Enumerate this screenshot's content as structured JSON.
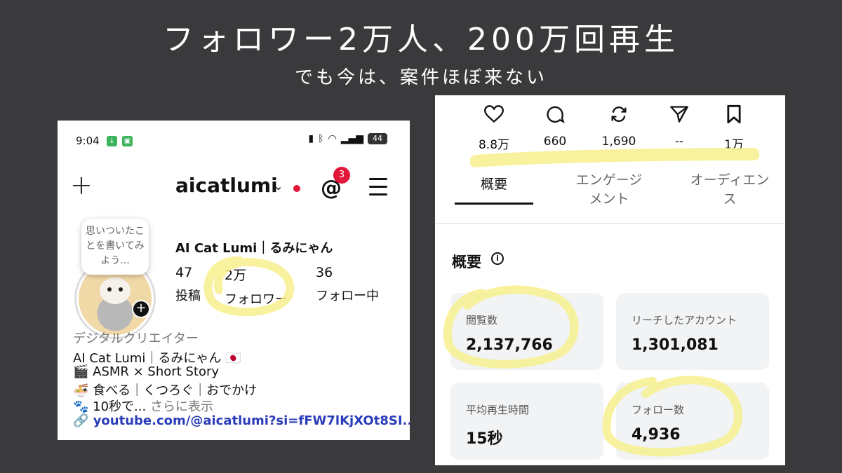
{
  "headline": "フォロワー2万人、200万回再生",
  "subheadline": "でも今は、案件ほぼ来ない",
  "profile_screen": {
    "status_bar": {
      "time": "9:04",
      "battery": "44"
    },
    "top_bar": {
      "username": "aicatlumi",
      "threads_badge": "3"
    },
    "note_bubble": "思いついたことを書いてみよう...",
    "display_name": "AI Cat Lumi｜るみにゃん",
    "stats": [
      {
        "value": "47",
        "label": "投稿"
      },
      {
        "value": "2万",
        "label": "フォロワー"
      },
      {
        "value": "36",
        "label": "フォロー中"
      }
    ],
    "category": "デジタルクリエイター",
    "bio_lines": [
      "AI Cat Lumi｜るみにゃん 🇯🇵",
      "🎬 ASMR × Short Story",
      "🍜 食べる｜くつろぐ｜おでかけ"
    ],
    "bio_last_line": "🐾 10秒で...",
    "more_label": "さらに表示",
    "link_text": "youtube.com/@aicatlumi?si=fFW7lKjXOt8SI..."
  },
  "insights_screen": {
    "actions": [
      {
        "icon": "heart-icon",
        "count": "8.8万"
      },
      {
        "icon": "comment-icon",
        "count": "660"
      },
      {
        "icon": "repost-icon",
        "count": "1,690"
      },
      {
        "icon": "share-icon",
        "count": "--"
      },
      {
        "icon": "bookmark-icon",
        "count": "1万"
      }
    ],
    "tabs": [
      {
        "label": "概要",
        "active": true
      },
      {
        "label": "エンゲージメント",
        "active": false
      },
      {
        "label": "オーディエンス",
        "active": false
      }
    ],
    "section_title": "概要",
    "cards": [
      {
        "label": "閲覧数",
        "value": "2,137,766"
      },
      {
        "label": "リーチしたアカウント",
        "value": "1,301,081"
      },
      {
        "label": "平均再生時間",
        "value": "15秒"
      },
      {
        "label": "フォロー数",
        "value": "4,936"
      }
    ]
  },
  "colors": {
    "background": "#3a3a3d",
    "highlight": "#f7f08e",
    "badge_red": "#e3163c",
    "link_blue": "#2a3cb8"
  }
}
